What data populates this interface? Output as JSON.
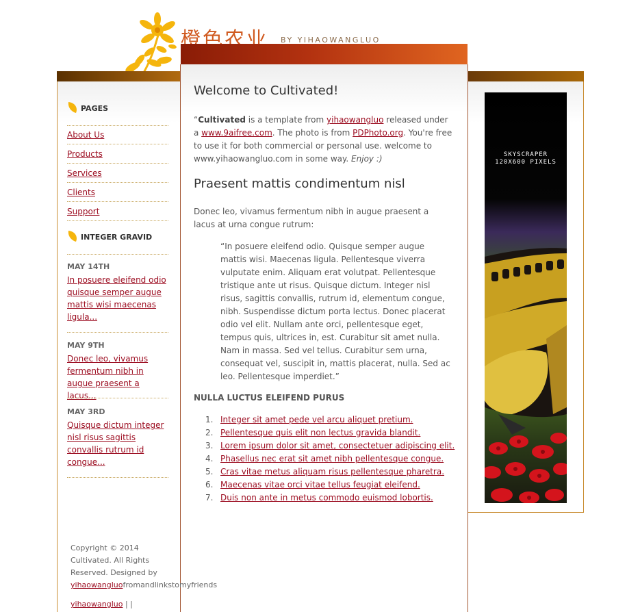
{
  "header": {
    "site_title": "橙色农业",
    "byline": "BY YIHAOWANGLUO"
  },
  "sidebar": {
    "pages_title": "PAGES",
    "pages": [
      {
        "label": "About Us"
      },
      {
        "label": "Products"
      },
      {
        "label": "Services"
      },
      {
        "label": "Clients"
      },
      {
        "label": "Support"
      }
    ],
    "news_title": "INTEGER GRAVID",
    "news": [
      {
        "date": "MAY 14TH",
        "text": "In posuere eleifend odio quisque semper augue mattis wisi maecenas ligula..."
      },
      {
        "date": "MAY 9TH",
        "text": "Donec leo, vivamus fermentum nibh in augue praesent a lacus..."
      },
      {
        "date": "MAY 3RD",
        "text": "Quisque dictum integer nisl risus sagittis convallis rutrum id congue..."
      }
    ]
  },
  "main": {
    "welcome_heading": "Welcome to Cultivated!",
    "intro": {
      "open_quote": "“",
      "brand": "Cultivated",
      "t1": " is a template from ",
      "link1": "yihaowangluo",
      "t2": " released under a ",
      "link2": "www.9aifree.com",
      "t3": ". The photo is from ",
      "link3": "PDPhoto.org",
      "t4": ". You're free to use it for both commercial or personal use. welcome to www.yihaowangluo.com in some way. ",
      "enjoy": "Enjoy :)"
    },
    "section_heading": "Praesent mattis condimentum nisl",
    "section_paragraph": "Donec leo, vivamus fermentum nibh in augue praesent a lacus at urna congue rutrum:",
    "blockquote": "“In posuere eleifend odio. Quisque semper augue mattis wisi. Maecenas ligula. Pellentesque viverra vulputate enim. Aliquam erat volutpat. Pellentesque tristique ante ut risus. Quisque dictum. Integer nisl risus, sagittis convallis, rutrum id, elementum congue, nibh. Suspendisse dictum porta lectus. Donec placerat odio vel elit. Nullam ante orci, pellentesque eget, tempus quis, ultrices in, est. Curabitur sit amet nulla. Nam in massa. Sed vel tellus. Curabitur sem urna, consequat vel, suscipit in, mattis placerat, nulla. Sed ac leo. Pellentesque imperdiet.”",
    "subheading": "NULLA LUCTUS ELEIFEND PURUS",
    "list": [
      {
        "num": "1.",
        "text": "Integer sit amet pede vel arcu aliquet pretium."
      },
      {
        "num": "2.",
        "text": "Pellentesque quis elit non lectus gravida blandit."
      },
      {
        "num": "3.",
        "text": "Lorem ipsum dolor sit amet, consectetuer adipiscing elit."
      },
      {
        "num": "4.",
        "text": "Phasellus nec erat sit amet nibh pellentesque congue."
      },
      {
        "num": "5.",
        "text": "Cras vitae metus aliquam risus pellentesque pharetra."
      },
      {
        "num": "6.",
        "text": "Maecenas vitae orci vitae tellus feugiat eleifend."
      },
      {
        "num": "7.",
        "text": "Duis non ante in metus commodo euismod lobortis."
      }
    ]
  },
  "ad": {
    "line1": "SKYSCRAPER",
    "line2": "120X600 PIXELS"
  },
  "footer": {
    "copyright": "Copyright © 2014 Cultivated. All Rights Reserved. Designed by ",
    "designer_link": "yihaowangluo",
    "designer_suffix": "fromandlinkstomyfriends",
    "bottom_link": "yihaowangluo",
    "separators": " | |"
  },
  "colors": {
    "link": "#9b0a1e",
    "title_orange": "#d05a20",
    "bar_brown": "#8a1c06"
  }
}
